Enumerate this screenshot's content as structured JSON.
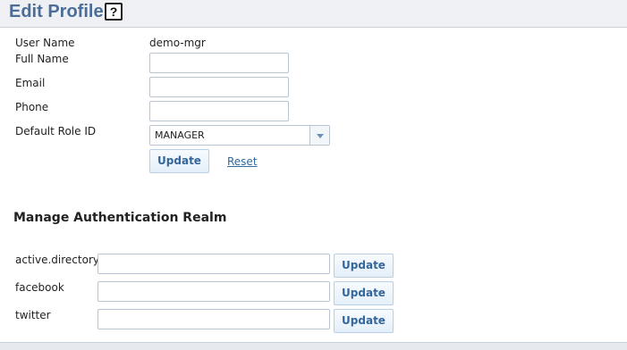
{
  "header": {
    "title": "Edit Profile",
    "help_icon": "?"
  },
  "profile": {
    "user_name_label": "User Name",
    "user_name_value": "demo-mgr",
    "full_name_label": "Full Name",
    "full_name_value": "",
    "email_label": "Email",
    "email_value": "",
    "phone_label": "Phone",
    "phone_value": "",
    "default_role_label": "Default Role ID",
    "default_role_value": "MANAGER",
    "update_label": "Update",
    "reset_label": "Reset"
  },
  "auth_realm": {
    "title": "Manage Authentication Realm",
    "realms": [
      {
        "label": "active.directory",
        "value": "",
        "button": "Update"
      },
      {
        "label": "facebook",
        "value": "",
        "button": "Update"
      },
      {
        "label": "twitter",
        "value": "",
        "button": "Update"
      }
    ]
  }
}
